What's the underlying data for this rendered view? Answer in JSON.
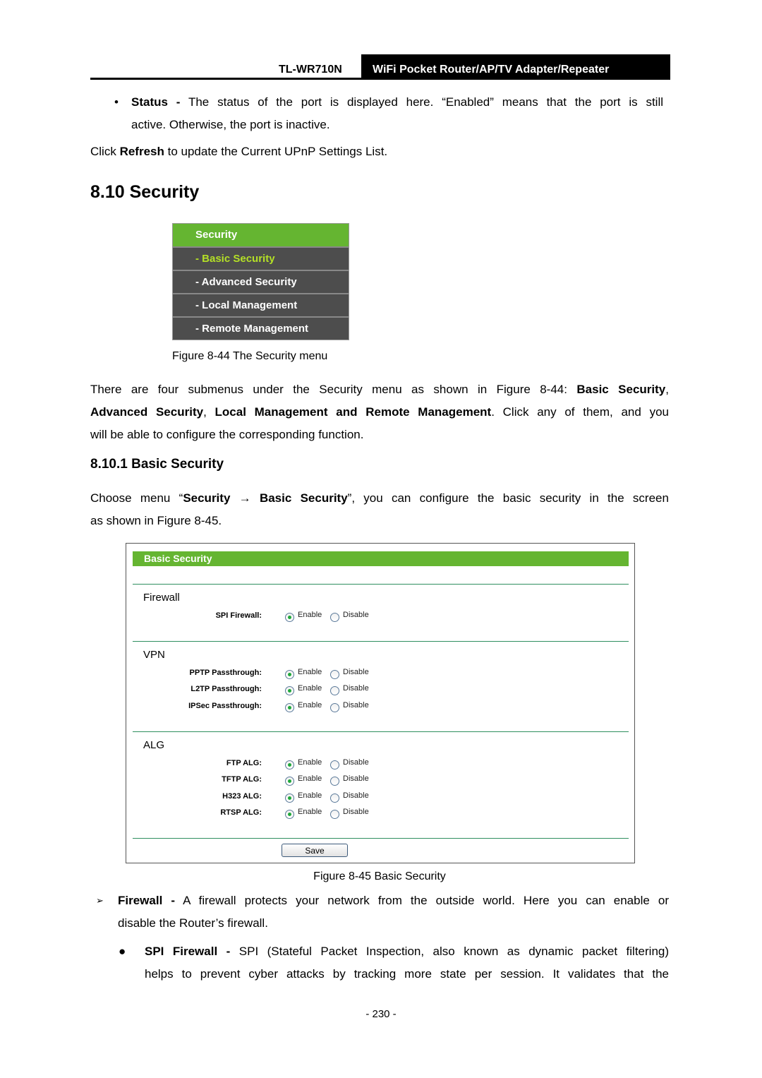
{
  "header": {
    "model": "TL-WR710N",
    "title": "WiFi Pocket Router/AP/TV Adapter/Repeater"
  },
  "intro": {
    "status_bold": "Status -",
    "status_text_line1": " The status of the port is displayed here. “Enabled” means that the port is still",
    "status_text_line2": "active. Otherwise, the port is inactive.",
    "refresh_pre": "Click ",
    "refresh_bold": "Refresh",
    "refresh_post": " to update the Current UPnP Settings List."
  },
  "section": {
    "heading": "8.10 Security"
  },
  "security_menu": {
    "header": "Security",
    "items": [
      {
        "label": "- Basic Security",
        "active": true
      },
      {
        "label": "- Advanced Security",
        "active": false
      },
      {
        "label": "- Local Management",
        "active": false
      },
      {
        "label": "- Remote Management",
        "active": false
      }
    ],
    "caption": "Figure 8-44 The Security menu"
  },
  "submenu_paragraph": {
    "line1_text": "There are four submenus under the Security menu as shown in Figure 8-44: ",
    "line1_bold": "Basic Security",
    "line1_end": ",",
    "line2_bold1": "Advanced Security",
    "line2_comma": ", ",
    "line2_bold2": "Local Management and Remote Management",
    "line2_text": ". Click any of them, and you",
    "line3": "will be able to configure the corresponding function."
  },
  "subsection": {
    "heading": "8.10.1 Basic Security",
    "choose_pre": "Choose menu “",
    "choose_bold1": "Security",
    "arrow": " → ",
    "choose_bold2": "Basic Security",
    "choose_post": "”, you can configure the basic security in the screen",
    "choose_line2": "as shown in Figure 8-45."
  },
  "basic_security_panel": {
    "title": "Basic Security",
    "enable_label": "Enable",
    "disable_label": "Disable",
    "sections": [
      {
        "title": "Firewall",
        "rows": [
          {
            "label": "SPI Firewall:",
            "value": "Enable"
          }
        ]
      },
      {
        "title": "VPN",
        "rows": [
          {
            "label": "PPTP Passthrough:",
            "value": "Enable"
          },
          {
            "label": "L2TP Passthrough:",
            "value": "Enable"
          },
          {
            "label": "IPSec Passthrough:",
            "value": "Enable"
          }
        ]
      },
      {
        "title": "ALG",
        "rows": [
          {
            "label": "FTP ALG:",
            "value": "Enable"
          },
          {
            "label": "TFTP ALG:",
            "value": "Enable"
          },
          {
            "label": "H323 ALG:",
            "value": "Enable"
          },
          {
            "label": "RTSP ALG:",
            "value": "Enable"
          }
        ]
      }
    ],
    "save_label": "Save",
    "caption": "Figure 8-45 Basic Security"
  },
  "explanations": {
    "firewall_bold": "Firewall -",
    "firewall_text_line1": " A firewall protects your network from the outside world. Here you can enable or",
    "firewall_text_line2": "disable the Router’s firewall.",
    "spi_bold": "SPI Firewall -",
    "spi_text_line1": " SPI (Stateful Packet Inspection, also known as dynamic packet filtering)",
    "spi_text_line2": "helps to prevent cyber attacks by tracking more state per session. It validates that the"
  },
  "footer": {
    "page_number": "- 230 -"
  }
}
